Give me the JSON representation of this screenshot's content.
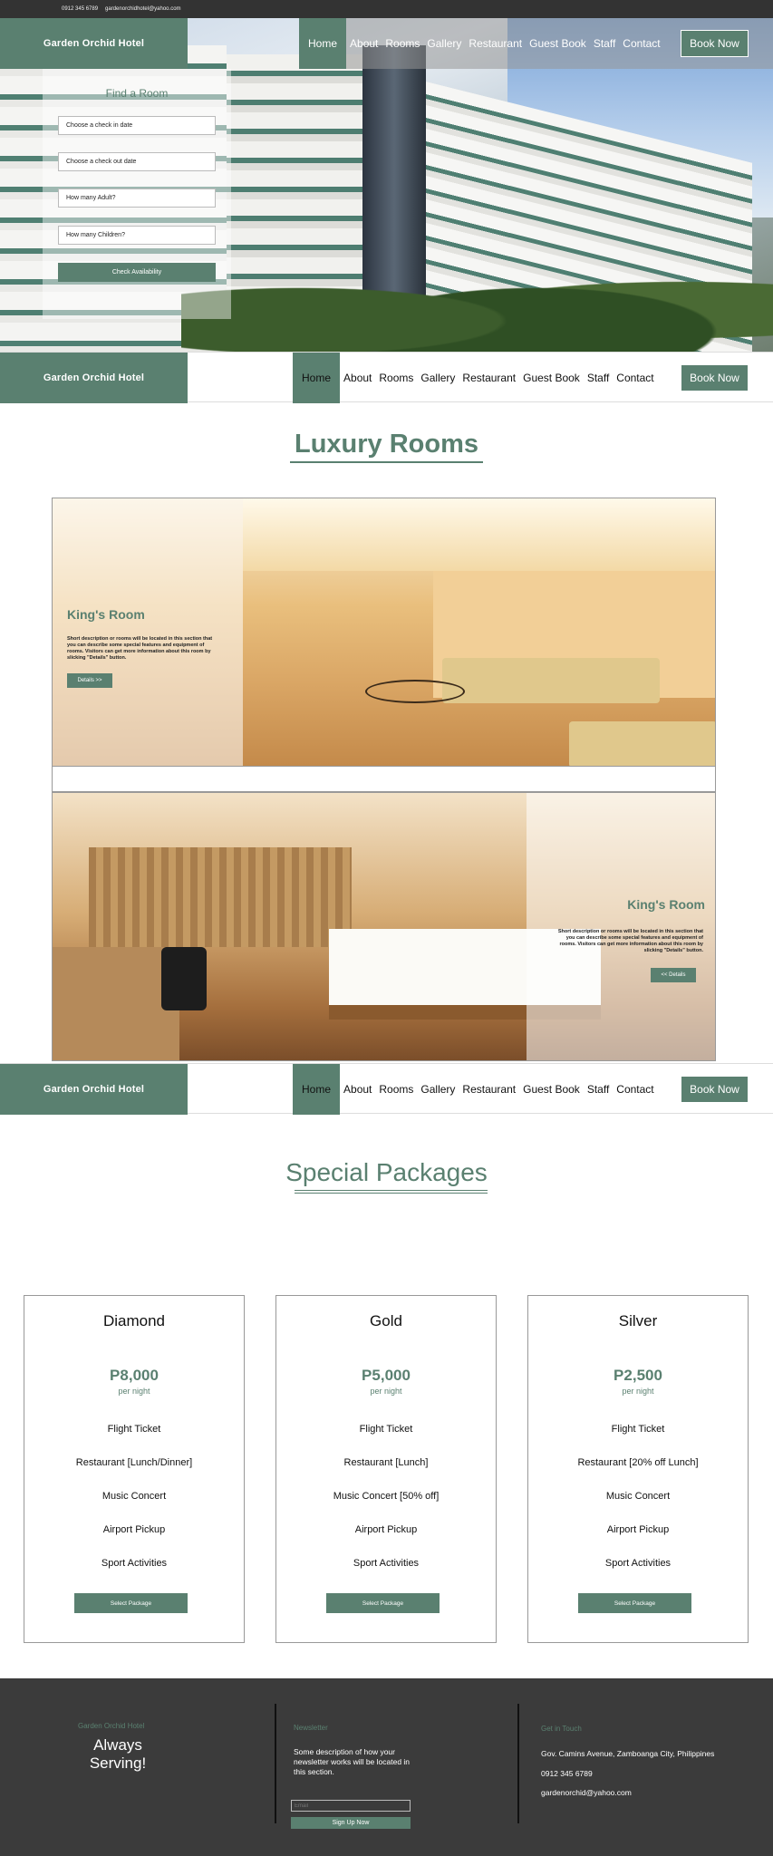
{
  "topbar": {
    "phone": "0912 345 6789",
    "email": "gardenorchidhotel@yahoo.com"
  },
  "brand": "Garden Orchid Hotel",
  "nav": [
    "Home",
    "About",
    "Rooms",
    "Gallery",
    "Restaurant",
    "Guest Book",
    "Staff",
    "Contact"
  ],
  "book_now": "Book Now",
  "finder": {
    "title": "Find a Room",
    "checkin": "Choose a check in date",
    "checkout": "Choose a check out date",
    "adults": "How many Adult?",
    "children": "How many Children?",
    "button": "Check Availability"
  },
  "rooms": {
    "title": "Luxury Rooms",
    "items": [
      {
        "name": "King's Room",
        "desc": "Short description or rooms will be located in this section that you can describe some special features and equipment of rooms. Visitors can get more information about this room by slicking \"Details\" button.",
        "button": "Details >>"
      },
      {
        "name": "King's Room",
        "desc": "Short description or rooms will be located in this section that you can describe some special features and equipment of rooms. Visitors can get more information about this room by slicking \"Details\" button.",
        "button": "<< Details"
      }
    ]
  },
  "packages": {
    "title": "Special Packages",
    "select_label": "Select Package",
    "items": [
      {
        "name": "Diamond",
        "price": "P8,000",
        "per": "per night",
        "features": [
          "Flight Ticket",
          "Restaurant [Lunch/Dinner]",
          "Music Concert",
          "Airport Pickup",
          "Sport Activities"
        ]
      },
      {
        "name": "Gold",
        "price": "P5,000",
        "per": "per night",
        "features": [
          "Flight Ticket",
          "Restaurant [Lunch]",
          "Music Concert [50% off]",
          "Airport Pickup",
          "Sport Activities"
        ]
      },
      {
        "name": "Silver",
        "price": "P2,500",
        "per": "per night",
        "features": [
          "Flight Ticket",
          "Restaurant [20% off Lunch]",
          "Music Concert",
          "Airport Pickup",
          "Sport Activities"
        ]
      }
    ]
  },
  "footer": {
    "brand": "Garden Orchid Hotel",
    "slogan1": "Always",
    "slogan2": "Serving!",
    "newsletter_title": "Newsletter",
    "newsletter_desc": "Some description of how your newsletter works will be located in this section.",
    "email_placeholder": "Email",
    "signup": "Sign Up Now",
    "contact_title": "Get in Touch",
    "address": "Gov. Camins Avenue, Zamboanga City, Philippines",
    "phone": "0912 345 6789",
    "email": "gardenorchid@yahoo.com"
  },
  "colors": {
    "accent": "#5a8070",
    "dark": "#3b3b3b"
  }
}
